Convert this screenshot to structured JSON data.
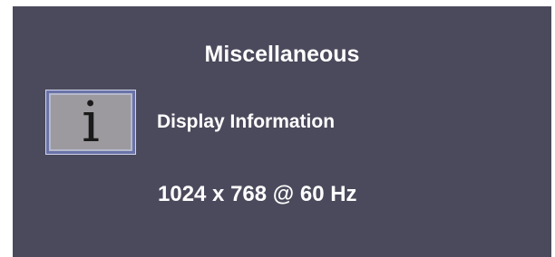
{
  "menu": {
    "title": "Miscellaneous",
    "item": {
      "label": "Display Information",
      "icon": "info-icon",
      "icon_glyph": "i"
    },
    "resolution_text": "1024 x 768 @ 60 Hz"
  },
  "colors": {
    "panel_background": "#4b4a5c",
    "text": "#ffffff",
    "icon_background": "#9c9a9e",
    "icon_border": "#6a73a8"
  }
}
